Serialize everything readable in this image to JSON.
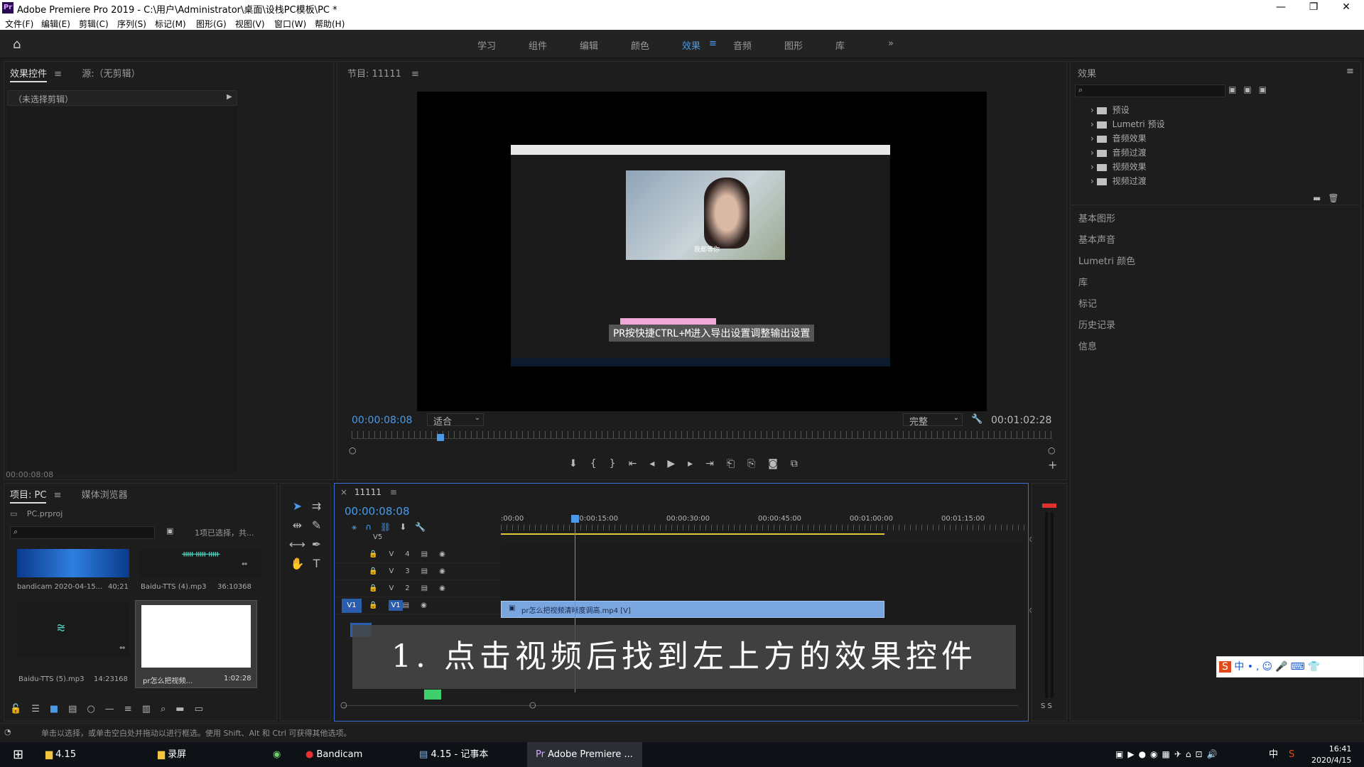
{
  "window": {
    "title": "Adobe Premiere Pro 2019 - C:\\用户\\Administrator\\桌面\\设栈PC模板\\PC *",
    "logo": "Pr"
  },
  "menu": [
    "文件(F)",
    "编辑(E)",
    "剪辑(C)",
    "序列(S)",
    "标记(M)",
    "图形(G)",
    "视图(V)",
    "窗口(W)",
    "帮助(H)"
  ],
  "workspaces": [
    "学习",
    "组件",
    "编辑",
    "颜色",
    "效果",
    "音频",
    "图形",
    "库"
  ],
  "workspace_active": "效果",
  "left_panel": {
    "tab1": "效果控件",
    "tab2": "源:（无剪辑）",
    "no_clip": "（未选择剪辑）",
    "timecode": "00:00:08:08"
  },
  "program": {
    "title": "节目: 11111",
    "timecode": "00:00:08:08",
    "fit": "适合",
    "quality": "完整",
    "duration": "00:01:02:28",
    "subtitle": "PR按快捷CTRL+M进入导出设置调整输出设置",
    "inner_caption": "我都等你"
  },
  "effects_panel": {
    "title": "效果",
    "items": [
      "预设",
      "Lumetri 预设",
      "音频效果",
      "音频过渡",
      "视频效果",
      "视频过渡"
    ],
    "sections": [
      "基本图形",
      "基本声音",
      "Lumetri 颜色",
      "库",
      "标记",
      "历史记录",
      "信息"
    ]
  },
  "project": {
    "tab1": "项目: PC",
    "tab2": "媒体浏览器",
    "file": "PC.prproj",
    "selection": "1项已选择，共...",
    "items": [
      {
        "name": "bandicam 2020-04-15...",
        "dur": "40;21"
      },
      {
        "name": "Baidu-TTS (4).mp3",
        "dur": "36:10368"
      },
      {
        "name": "Baidu-TTS (5).mp3",
        "dur": "14:23168"
      },
      {
        "name": "pr怎么把视频...",
        "dur": "1:02:28"
      }
    ]
  },
  "timeline": {
    "seq": "11111",
    "timecode": "00:00:08:08",
    "ruler": [
      ":00:00",
      "00:00:15:00",
      "00:00:30:00",
      "00:00:45:00",
      "00:01:00:00",
      "00:01:15:00"
    ],
    "tracks": [
      "V5",
      "V4",
      "V3",
      "V2",
      "V1"
    ],
    "clip": "pr怎么把视频清晰度调高.mp4 [V]",
    "playhead_fraction": 0.14
  },
  "overlay_caption": "1. 点击视频后找到左上方的效果控件",
  "status": "单击以选择，或单击空白处并拖动以进行框选。使用 Shift、Alt 和 Ctrl 可获得其他选项。",
  "meter_label": "S S",
  "taskbar": {
    "items": [
      "4.15",
      "录屏",
      "Bandicam",
      "4.15 - 记事本",
      "Adobe Premiere ..."
    ],
    "ime": "中",
    "time": "16:41",
    "date": "2020/4/15"
  },
  "colors": {
    "accent": "#4a9ae8",
    "clip": "#7aa6e0",
    "subtitle_bg": "#555555"
  }
}
